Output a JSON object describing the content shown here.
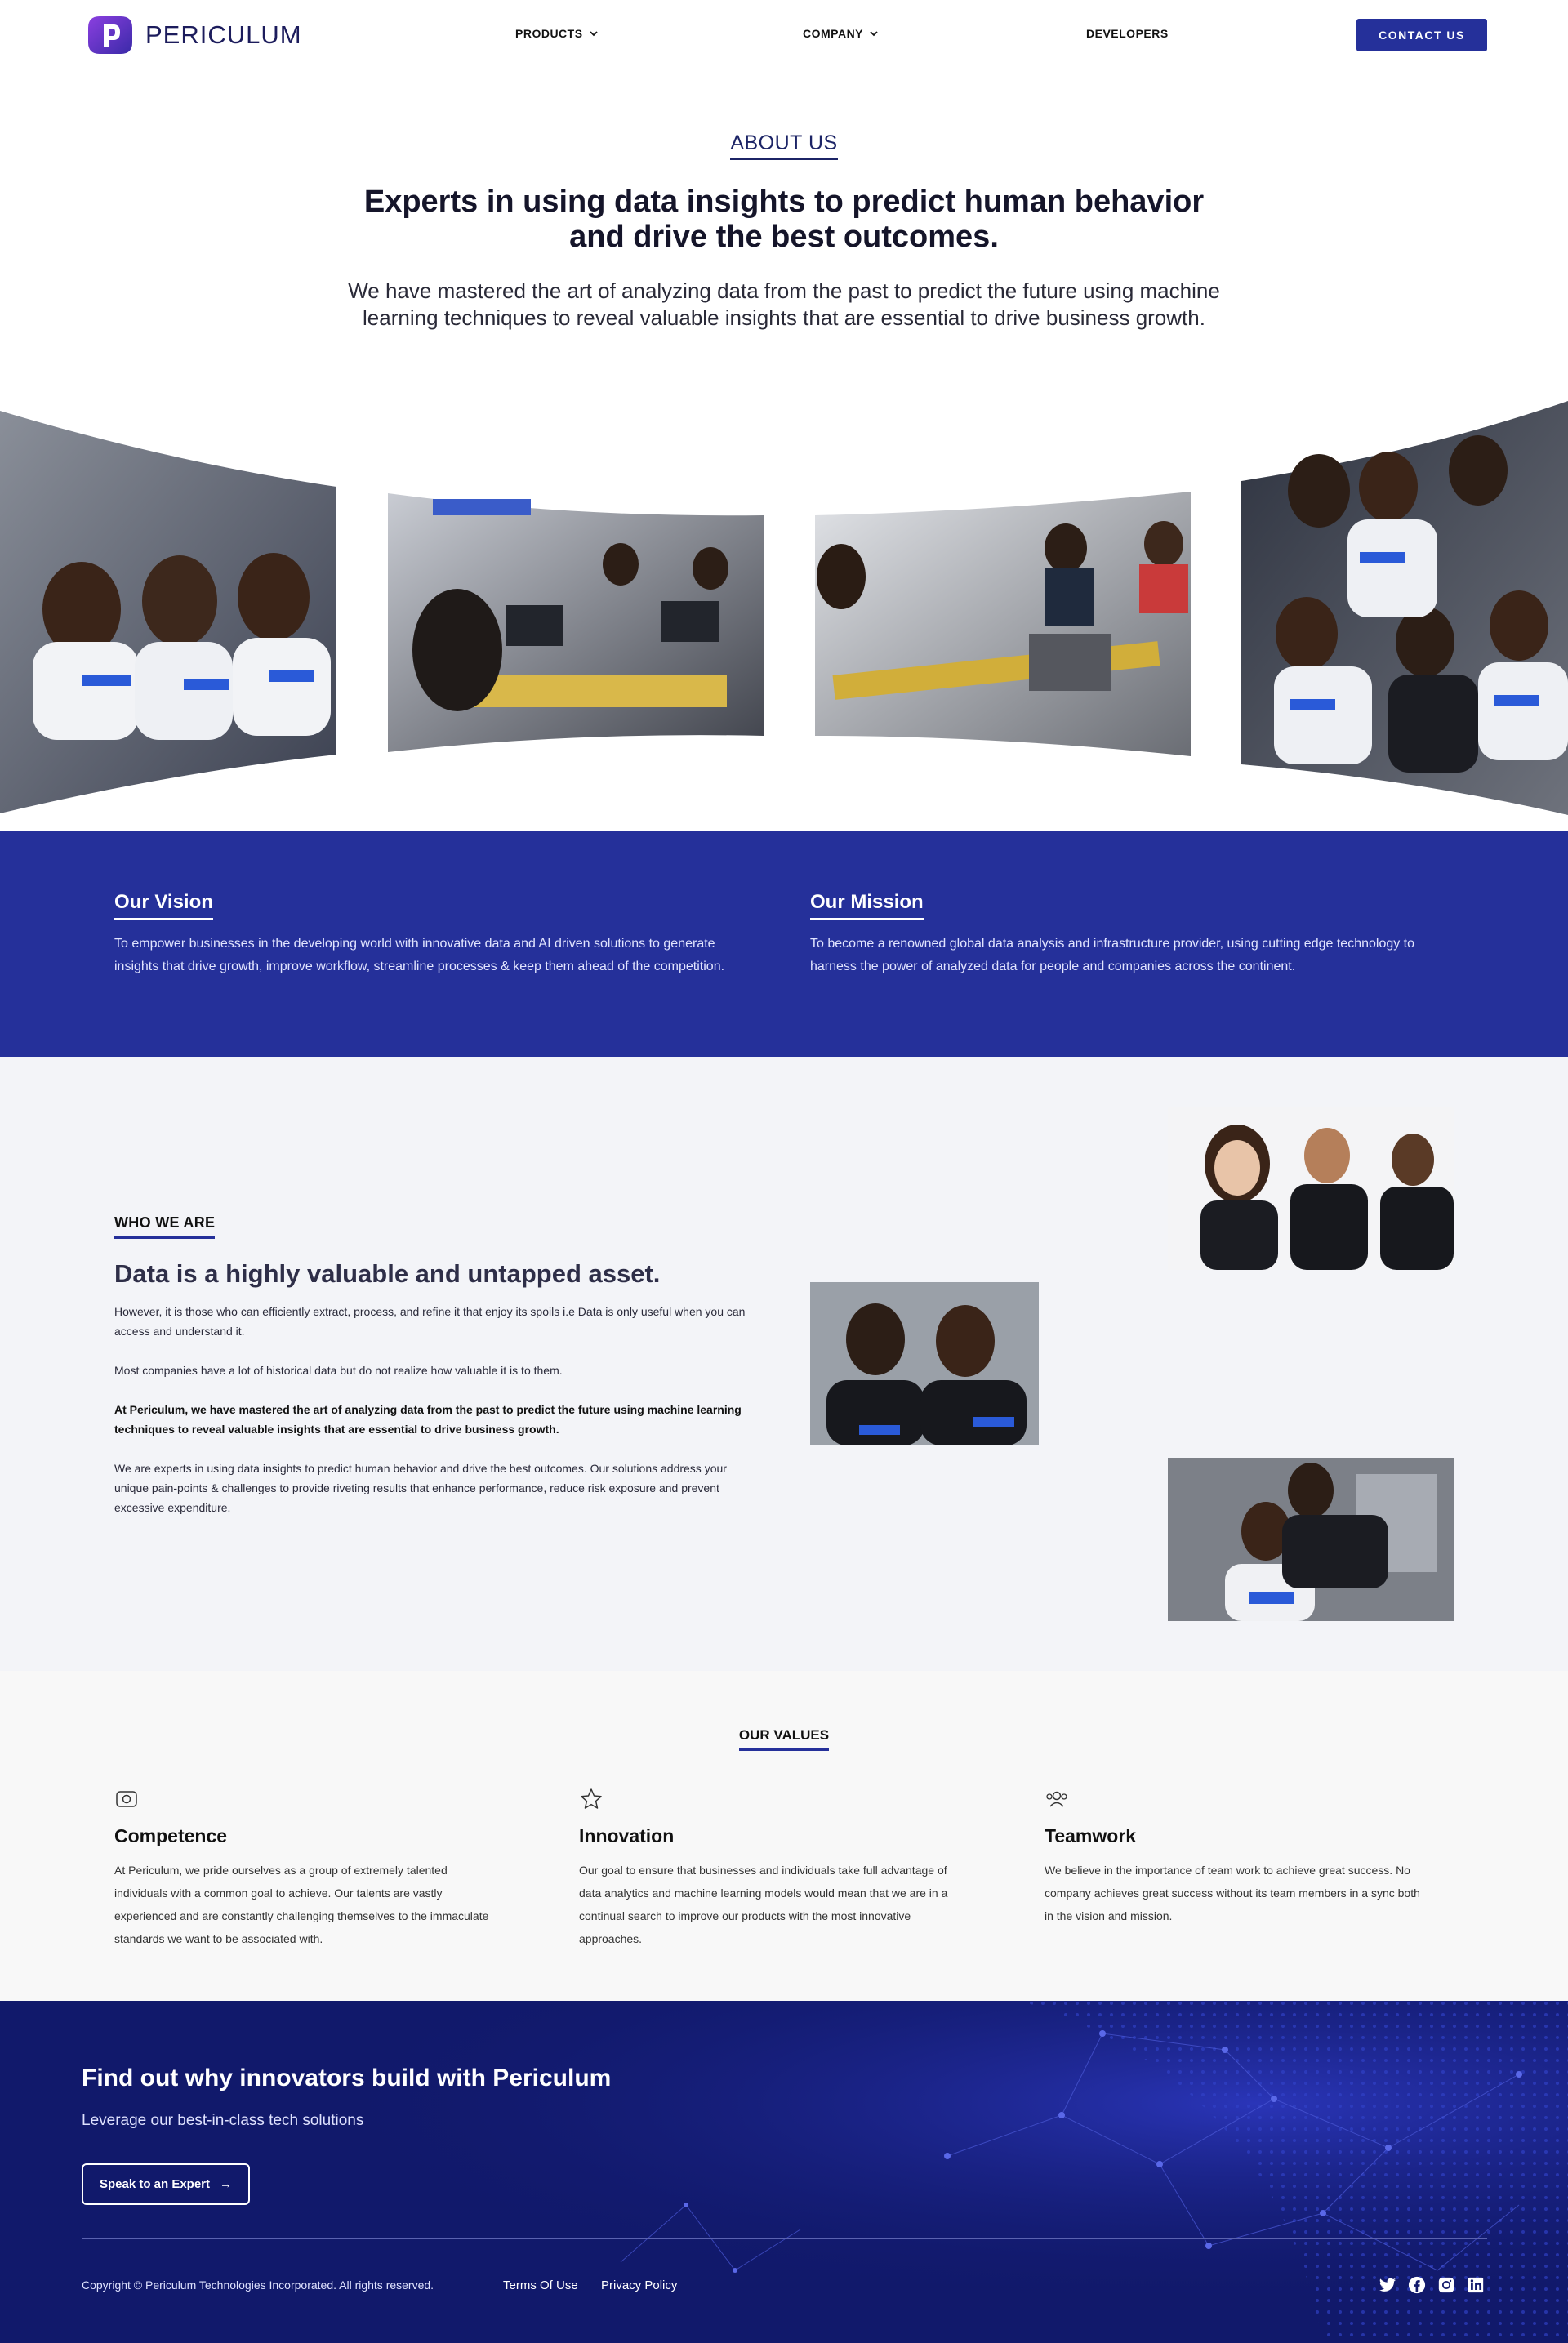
{
  "nav": {
    "logo_text": "PERICULUM",
    "products": "PRODUCTS",
    "company": "COMPANY",
    "developers": "DEVELOPERS",
    "contact": "CONTACT US"
  },
  "about": {
    "eyebrow": "ABOUT US",
    "title": "Experts in using data insights to predict human behavior and drive the best outcomes.",
    "text": "We have mastered the art of analyzing data from the past to predict the future using machine learning techniques to reveal valuable insights that are essential to drive business growth."
  },
  "vision": {
    "title": "Our Vision",
    "text": "To empower businesses in the developing world with innovative data and AI driven solutions to generate insights that drive growth, improve workflow, streamline processes & keep them ahead of the competition."
  },
  "mission": {
    "title": "Our Mission",
    "text": "To become a renowned global data analysis and infrastructure provider, using cutting edge technology to harness the power of analyzed data for people and companies across the continent."
  },
  "who": {
    "eyebrow": "WHO WE ARE",
    "title": "Data is a highly valuable and untapped asset.",
    "p1": "However, it is those who can efficiently extract, process, and refine it that enjoy its spoils i.e Data is only useful when you can access and understand it.",
    "p2": "Most companies have a lot of historical data but do not realize how valuable it is to them.",
    "p3": "At Periculum, we have mastered the art of analyzing data from the past to predict the future using machine learning techniques to reveal valuable insights that are essential to drive business growth.",
    "p4": "We are experts in using data insights to predict human behavior and drive the best outcomes. Our solutions address your unique pain-points & challenges to provide riveting results that enhance performance, reduce risk exposure and prevent excessive expenditure."
  },
  "values": {
    "eyebrow": "OUR VALUES",
    "items": [
      {
        "icon": "badge-icon",
        "title": "Competence",
        "text": "At Periculum, we pride ourselves as a group of extremely talented individuals with a common goal to achieve. Our talents are vastly experienced and are constantly challenging themselves to the immaculate standards we want to be associated with."
      },
      {
        "icon": "star-icon",
        "title": "Innovation",
        "text": "Our goal to ensure that businesses and individuals take full advantage of data analytics and machine learning models would mean that we are in a continual search to improve our products with the most innovative approaches."
      },
      {
        "icon": "team-icon",
        "title": "Teamwork",
        "text": "We believe in the importance of team work to achieve great success. No company achieves great success without its team members in a sync both in the vision and mission."
      }
    ]
  },
  "cta": {
    "title": "Find out why innovators build with Periculum",
    "subtitle": "Leverage our best-in-class tech solutions",
    "button": "Speak to an Expert",
    "button_arrow": "→"
  },
  "footer": {
    "copyright": "Copyright © Periculum Technologies Incorporated. All rights reserved.",
    "terms": "Terms Of Use",
    "privacy": "Privacy Policy",
    "social": [
      "twitter-icon",
      "facebook-icon",
      "instagram-icon",
      "linkedin-icon"
    ]
  },
  "colors": {
    "brand": "#25309a",
    "footer_bg": "#11196b",
    "logo_purple": "#6b2bc9"
  }
}
